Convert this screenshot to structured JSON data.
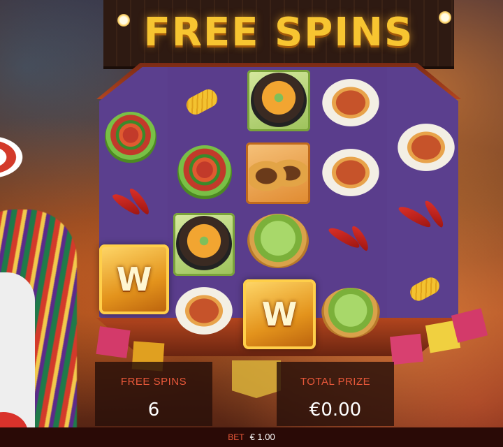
{
  "game": {
    "title": "FREE SPINS",
    "free_spins_label": "FREE SPINS",
    "free_spins_value": "6",
    "total_prize_label": "TOTAL PRIZE",
    "total_prize_value": "€0.00",
    "bet_label": "BET",
    "bet_value": "€ 1.00",
    "wild_letter": "W"
  },
  "reels": [
    [
      "bowl-salsa",
      "chili",
      "wild"
    ],
    [
      "corn",
      "bowl-salsa",
      "bowl-nachos",
      "plate-fries"
    ],
    [
      "bowl-nachos",
      "tacos",
      "bowl-guacamole",
      "wild"
    ],
    [
      "plate-fries",
      "plate-fries",
      "chili",
      "bowl-guacamole"
    ],
    [
      "plate-fries",
      "chili",
      "corn"
    ]
  ],
  "colors": {
    "title_gold": "#f7c531",
    "reel_purple": "#5b3f8e",
    "label_red": "#e8583a",
    "wood": "#b2451e"
  }
}
